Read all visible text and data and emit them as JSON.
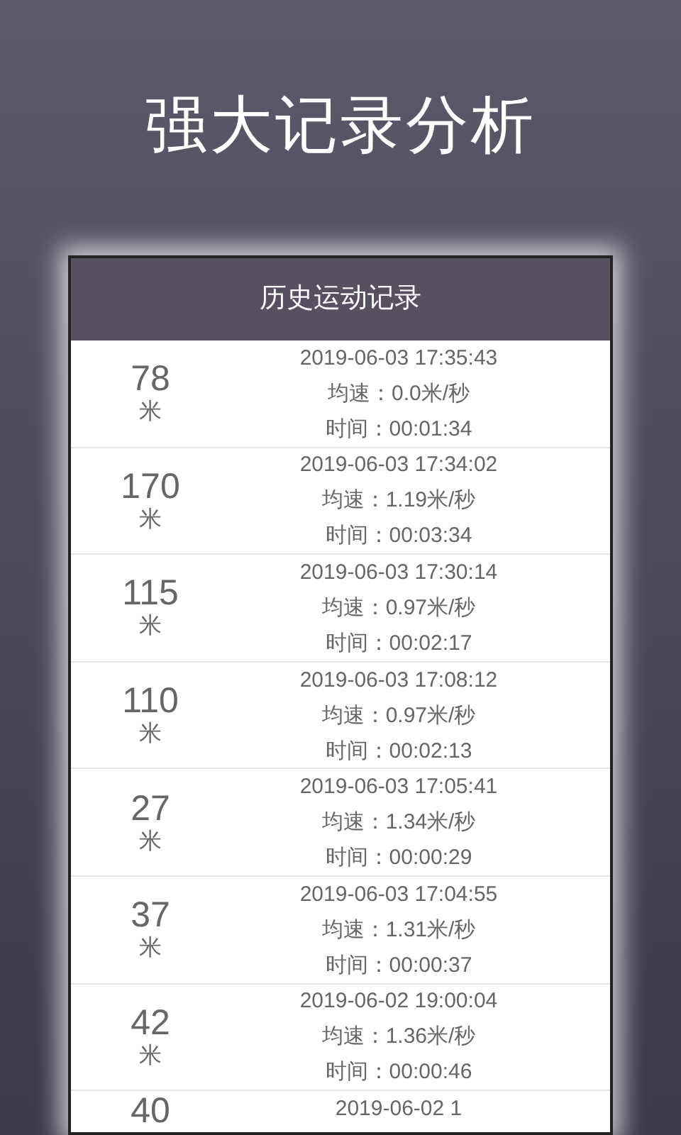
{
  "headline": "强大记录分析",
  "card": {
    "title": "历史运动记录"
  },
  "records": [
    {
      "distance": "78",
      "unit": "米",
      "date": "2019-06-03 17:35:43",
      "speed": "均速：0.0米/秒",
      "duration": "时间：00:01:34"
    },
    {
      "distance": "170",
      "unit": "米",
      "date": "2019-06-03 17:34:02",
      "speed": "均速：1.19米/秒",
      "duration": "时间：00:03:34"
    },
    {
      "distance": "115",
      "unit": "米",
      "date": "2019-06-03 17:30:14",
      "speed": "均速：0.97米/秒",
      "duration": "时间：00:02:17"
    },
    {
      "distance": "110",
      "unit": "米",
      "date": "2019-06-03 17:08:12",
      "speed": "均速：0.97米/秒",
      "duration": "时间：00:02:13"
    },
    {
      "distance": "27",
      "unit": "米",
      "date": "2019-06-03 17:05:41",
      "speed": "均速：1.34米/秒",
      "duration": "时间：00:00:29"
    },
    {
      "distance": "37",
      "unit": "米",
      "date": "2019-06-03 17:04:55",
      "speed": "均速：1.31米/秒",
      "duration": "时间：00:00:37"
    },
    {
      "distance": "42",
      "unit": "米",
      "date": "2019-06-02 19:00:04",
      "speed": "均速：1.36米/秒",
      "duration": "时间：00:00:46"
    },
    {
      "distance": "40",
      "date": "2019-06-02 1"
    }
  ]
}
